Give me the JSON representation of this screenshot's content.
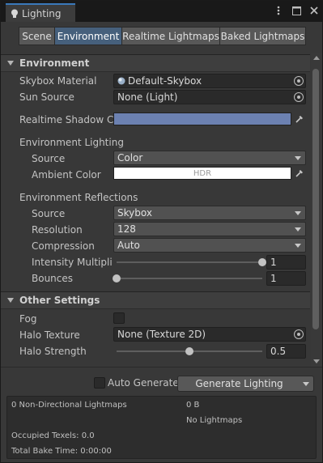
{
  "window": {
    "tab_title": "Lighting",
    "icons": [
      "more-menu-icon",
      "maximize-icon",
      "close-icon"
    ]
  },
  "tabs": [
    {
      "label": "Scene",
      "active": false
    },
    {
      "label": "Environment",
      "active": true
    },
    {
      "label": "Realtime Lightmaps",
      "active": false
    },
    {
      "label": "Baked Lightmaps",
      "active": false
    }
  ],
  "environment": {
    "header": "Environment",
    "skybox_material_label": "Skybox Material",
    "skybox_material_value": "Default-Skybox",
    "sun_source_label": "Sun Source",
    "sun_source_value": "None (Light)",
    "realtime_shadow_label": "Realtime Shadow Co",
    "realtime_shadow_color": "#6c81b1",
    "env_lighting_title": "Environment Lighting",
    "source_label": "Source",
    "source_value": "Color",
    "ambient_color_label": "Ambient Color",
    "ambient_color_text": "HDR",
    "ambient_color": "#ffffff",
    "env_reflections_title": "Environment Reflections",
    "refl_source_label": "Source",
    "refl_source_value": "Skybox",
    "resolution_label": "Resolution",
    "resolution_value": "128",
    "compression_label": "Compression",
    "compression_value": "Auto",
    "intensity_label": "Intensity Multiplie",
    "intensity_value": "1",
    "intensity_fraction": 1.0,
    "bounces_label": "Bounces",
    "bounces_value": "1",
    "bounces_fraction": 0.0
  },
  "other": {
    "header": "Other Settings",
    "fog_label": "Fog",
    "fog_checked": false,
    "halo_texture_label": "Halo Texture",
    "halo_texture_value": "None (Texture 2D)",
    "halo_strength_label": "Halo Strength",
    "halo_strength_value": "0.5",
    "halo_strength_fraction": 0.5
  },
  "bottom": {
    "auto_generate_label": "Auto Generate",
    "auto_generate_checked": false,
    "generate_label": "Generate Lighting"
  },
  "stats": {
    "lightmaps": "0 Non-Directional Lightmaps",
    "size": "0 B",
    "no_lightmaps": "No Lightmaps",
    "occupied": "Occupied Texels: 0.0",
    "bake_time": "Total Bake Time: 0:00:00"
  }
}
